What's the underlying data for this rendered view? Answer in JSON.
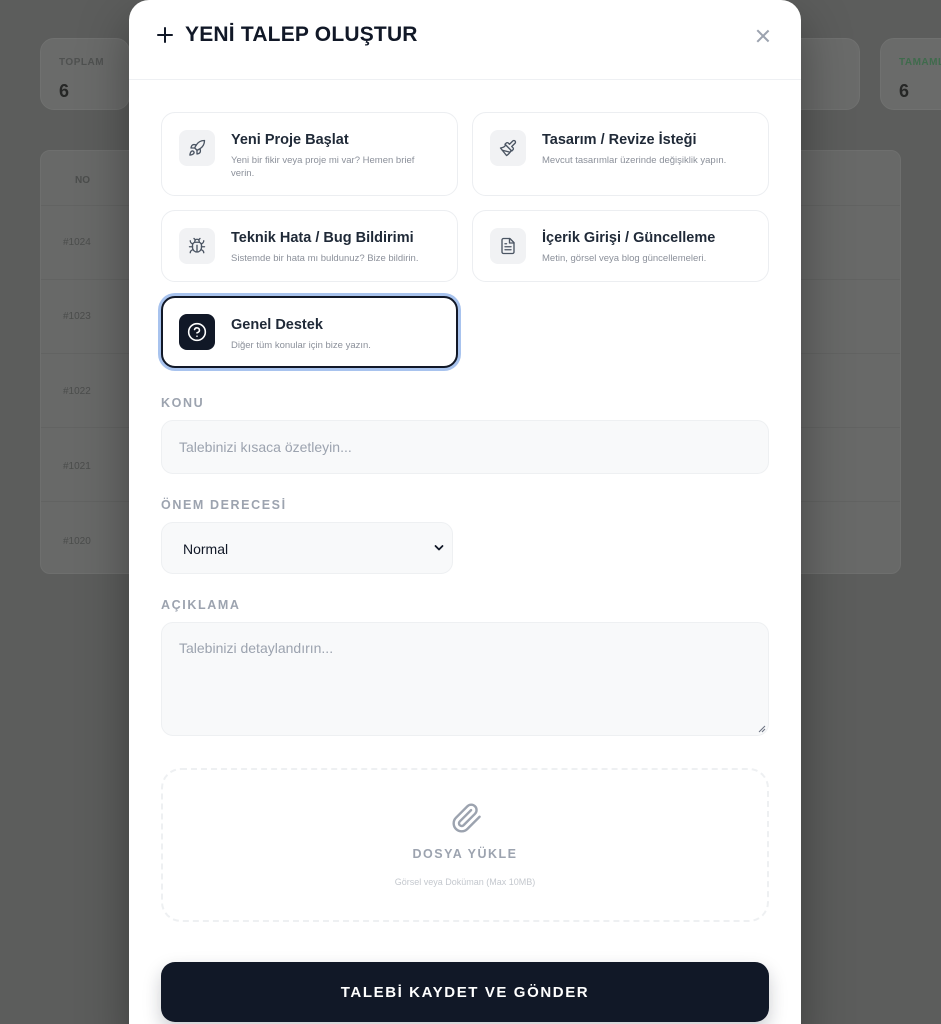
{
  "background": {
    "stats": [
      {
        "label": "TOPLAM",
        "value": "6"
      },
      {
        "label": "TAMAMLANAN",
        "value": "6"
      }
    ],
    "table": {
      "header": "NO",
      "rows": [
        "#1024",
        "#1023",
        "#1022",
        "#1021",
        "#1020"
      ]
    }
  },
  "modal": {
    "title": "YENİ TALEP OLUŞTUR",
    "close_icon": "close-icon",
    "request_types": [
      {
        "name": "Yeni Proje Başlat",
        "description": "Yeni bir fikir veya proje mi var? Hemen brief verin.",
        "icon": "rocket-icon",
        "selected": false
      },
      {
        "name": "Tasarım / Revize İsteği",
        "description": "Mevcut tasarımlar üzerinde değişiklik yapın.",
        "icon": "brush-icon",
        "selected": false
      },
      {
        "name": "Teknik Hata / Bug Bildirimi",
        "description": "Sistemde bir hata mı buldunuz? Bize bildirin.",
        "icon": "bug-icon",
        "selected": false
      },
      {
        "name": "İçerik Girişi / Güncelleme",
        "description": "Metin, görsel veya blog güncellemeleri.",
        "icon": "document-icon",
        "selected": false
      },
      {
        "name": "Genel Destek",
        "description": "Diğer tüm konular için bize yazın.",
        "icon": "help-circle-icon",
        "selected": true
      }
    ],
    "subject": {
      "label": "KONU",
      "placeholder": "Talebinizi kısaca özetleyin..."
    },
    "priority": {
      "label": "ÖNEM DERECESİ",
      "value": "Normal"
    },
    "description": {
      "label": "AÇIKLAMA",
      "placeholder": "Talebinizi detaylandırın..."
    },
    "upload": {
      "title": "DOSYA YÜKLE",
      "subtitle": "Görsel veya Doküman (Max 10MB)",
      "icon": "paperclip-icon"
    },
    "submit_label": "TALEBİ KAYDET VE GÖNDER"
  },
  "colors": {
    "primary": "#111827",
    "selected_ring": "#a8c3ee",
    "muted_text": "#9ca3af",
    "input_bg": "#f8f9fa",
    "overlay": "#5c5d5c"
  }
}
